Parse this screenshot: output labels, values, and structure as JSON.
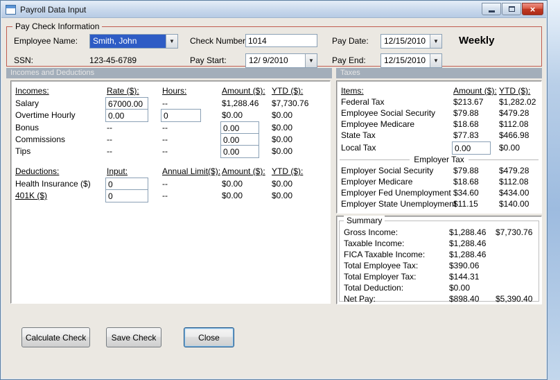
{
  "window": {
    "title": "Payroll Data Input"
  },
  "icons": {
    "dropdown_arrow": "▼",
    "close_glyph": "×"
  },
  "colors": {
    "group_border": "#c05c50",
    "band_bg": "#a3aeba",
    "selection_bg": "#2e5cc5",
    "close_button": "#c03a24"
  },
  "paycheck": {
    "group_title": "Pay Check Information",
    "employee_name_label": "Employee Name:",
    "employee_name_value": "Smith, John",
    "ssn_label": "SSN:",
    "ssn_value": "123-45-6789",
    "check_number_label": "Check Number:",
    "check_number_value": "1014",
    "pay_start_label": "Pay Start:",
    "pay_start_value": "12/ 9/2010",
    "pay_date_label": "Pay Date:",
    "pay_date_value": "12/15/2010",
    "pay_end_label": "Pay End:",
    "pay_end_value": "12/15/2010",
    "frequency_label": "Weekly"
  },
  "bands": {
    "incomes": "Incomes and Deductions",
    "taxes": "Taxes"
  },
  "incomes_table": {
    "headers": {
      "col0": "Incomes:",
      "col1": "Rate ($):",
      "col2": "Hours:",
      "col3": "Amount ($):",
      "col4": "YTD ($):"
    },
    "rows": [
      {
        "label": "Salary",
        "rate": "67000.00",
        "hours": "--",
        "amount": "$1,288.46",
        "ytd": "$7,730.76"
      },
      {
        "label": "Overtime Hourly",
        "rate": "0.00",
        "hours": "0",
        "amount": "$0.00",
        "ytd": "$0.00"
      },
      {
        "label": "Bonus",
        "rate": "--",
        "hours": "--",
        "amount": "0.00",
        "ytd": "$0.00"
      },
      {
        "label": "Commissions",
        "rate": "--",
        "hours": "--",
        "amount": "0.00",
        "ytd": "$0.00"
      },
      {
        "label": "Tips",
        "rate": "--",
        "hours": "--",
        "amount": "0.00",
        "ytd": "$0.00"
      }
    ]
  },
  "deductions_table": {
    "headers": {
      "col0": "Deductions:",
      "col1": "Input:",
      "col2": "Annual Limit($):",
      "col3": "Amount ($):",
      "col4": "YTD ($):"
    },
    "rows": [
      {
        "label": "Health Insurance ($)",
        "input": "0",
        "limit": "--",
        "amount": "$0.00",
        "ytd": "$0.00"
      },
      {
        "label": "401K ($)",
        "input": "0",
        "limit": "--",
        "amount": "$0.00",
        "ytd": "$0.00"
      }
    ]
  },
  "taxes_table": {
    "headers": {
      "col0": "Items:",
      "col1": "Amount ($):",
      "col2": "YTD ($):"
    },
    "employee_rows": [
      {
        "label": "Federal Tax",
        "amount": "$213.67",
        "ytd": "$1,282.02"
      },
      {
        "label": "Employee Social Security",
        "amount": "$79.88",
        "ytd": "$479.28"
      },
      {
        "label": "Employee Medicare",
        "amount": "$18.68",
        "ytd": "$112.08"
      },
      {
        "label": "State Tax",
        "amount": "$77.83",
        "ytd": "$466.98"
      },
      {
        "label": "Local Tax",
        "amount": "0.00",
        "ytd": "$0.00"
      }
    ],
    "employer_header": "Employer Tax",
    "employer_rows": [
      {
        "label": "Employer Social Security",
        "amount": "$79.88",
        "ytd": "$479.28"
      },
      {
        "label": "Employer Medicare",
        "amount": "$18.68",
        "ytd": "$112.08"
      },
      {
        "label": "Employer Fed Unemployment",
        "amount": "$34.60",
        "ytd": "$434.00"
      },
      {
        "label": "Employer State Unemployment",
        "amount": "$11.15",
        "ytd": "$140.00"
      }
    ]
  },
  "summary": {
    "group_title": "Summary",
    "rows": [
      {
        "label": "Gross Income:",
        "amount": "$1,288.46",
        "ytd": "$7,730.76"
      },
      {
        "label": "Taxable Income:",
        "amount": "$1,288.46",
        "ytd": ""
      },
      {
        "label": "FICA Taxable Income:",
        "amount": "$1,288.46",
        "ytd": ""
      },
      {
        "label": "Total Employee Tax:",
        "amount": "$390.06",
        "ytd": ""
      },
      {
        "label": "Total Employer Tax:",
        "amount": "$144.31",
        "ytd": ""
      },
      {
        "label": "Total Deduction:",
        "amount": "$0.00",
        "ytd": ""
      },
      {
        "label": "Net Pay:",
        "amount": "$898.40",
        "ytd": "$5,390.40"
      }
    ]
  },
  "buttons": {
    "calculate": "Calculate Check",
    "save": "Save Check",
    "close": "Close"
  }
}
